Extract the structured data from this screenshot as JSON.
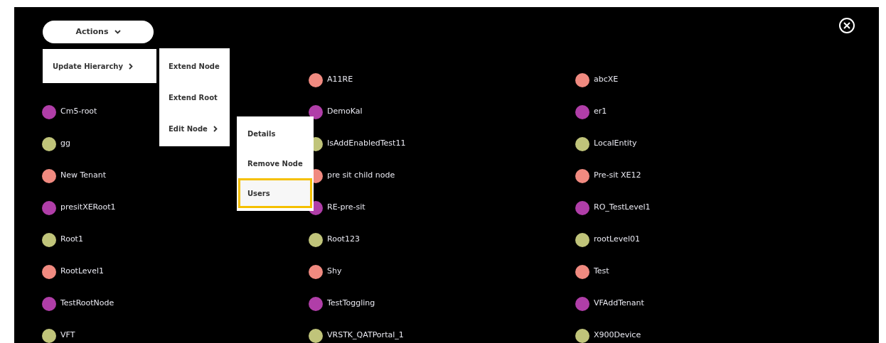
{
  "actions_button": {
    "label": "Actions"
  },
  "menus": [
    {
      "items": [
        {
          "label": "Update Hierarchy",
          "has_submenu": true,
          "selected": false
        }
      ]
    },
    {
      "items": [
        {
          "label": "Extend Node",
          "has_submenu": false,
          "selected": false
        },
        {
          "label": "Extend Root",
          "has_submenu": false,
          "selected": false
        },
        {
          "label": "Edit Node",
          "has_submenu": true,
          "selected": false
        }
      ]
    },
    {
      "items": [
        {
          "label": "Details",
          "has_submenu": false,
          "selected": false
        },
        {
          "label": "Remove Node",
          "has_submenu": false,
          "selected": false
        },
        {
          "label": "Users",
          "has_submenu": false,
          "selected": true
        }
      ]
    }
  ],
  "columns": [
    {
      "nodes": [
        {
          "name": "Cm5-root",
          "color": "#b03ea8"
        },
        {
          "name": "gg",
          "color": "#c0c47a"
        },
        {
          "name": "New Tenant",
          "color": "#f08a80"
        },
        {
          "name": "presitXERoot1",
          "color": "#b03ea8"
        },
        {
          "name": "Root1",
          "color": "#c0c47a"
        },
        {
          "name": "RootLevel1",
          "color": "#f08a80"
        },
        {
          "name": "TestRootNode",
          "color": "#b03ea8"
        },
        {
          "name": "VFT",
          "color": "#c0c47a"
        }
      ]
    },
    {
      "nodes": [
        {
          "name": "A11RE",
          "color": "#f08a80"
        },
        {
          "name": "DemoKal",
          "color": "#b03ea8"
        },
        {
          "name": "IsAddEnabledTest11",
          "color": "#c0c47a"
        },
        {
          "name": "pre sit child node",
          "color": "#f08a80"
        },
        {
          "name": "RE-pre-sit",
          "color": "#b03ea8"
        },
        {
          "name": "Root123",
          "color": "#c0c47a"
        },
        {
          "name": "Shy",
          "color": "#f08a80"
        },
        {
          "name": "TestToggling",
          "color": "#b03ea8"
        },
        {
          "name": "VRSTK_QATPortal_1",
          "color": "#c0c47a"
        }
      ]
    },
    {
      "nodes": [
        {
          "name": "abcXE",
          "color": "#f08a80"
        },
        {
          "name": "er1",
          "color": "#b03ea8"
        },
        {
          "name": "LocalEntity",
          "color": "#c0c47a"
        },
        {
          "name": "Pre-sit XE12",
          "color": "#f08a80"
        },
        {
          "name": "RO_TestLevel1",
          "color": "#b03ea8"
        },
        {
          "name": "rootLevel01",
          "color": "#c0c47a"
        },
        {
          "name": "Test",
          "color": "#f08a80"
        },
        {
          "name": "VFAddTenant",
          "color": "#b03ea8"
        },
        {
          "name": "X900Device",
          "color": "#c0c47a"
        }
      ]
    }
  ]
}
